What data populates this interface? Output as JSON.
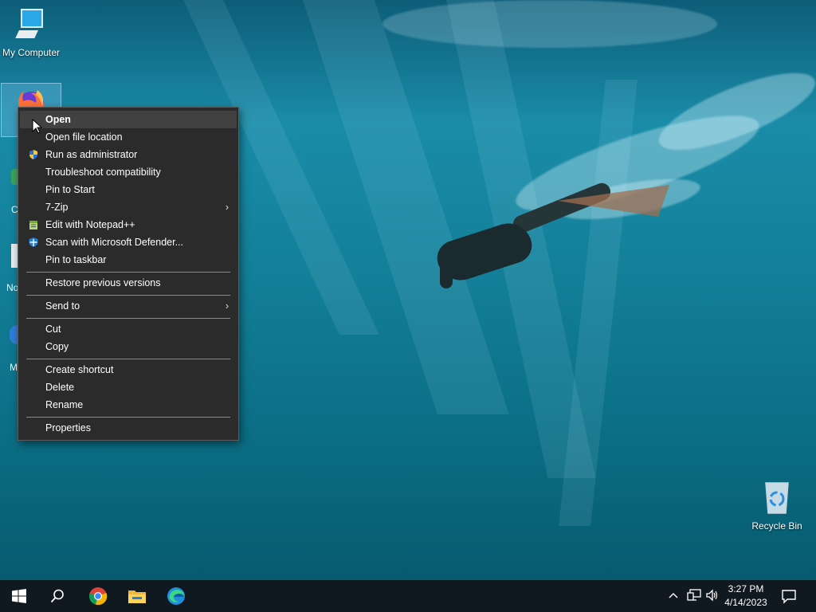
{
  "desktop": {
    "icons": [
      {
        "label": "My Computer"
      },
      {
        "label": "Recycle Bin"
      }
    ],
    "partial_labels": [
      "C",
      "No",
      "M"
    ]
  },
  "context_menu": {
    "items": [
      {
        "label": "Open",
        "highlighted": true
      },
      {
        "label": "Open file location"
      },
      {
        "label": "Run as administrator",
        "icon": "uac-shield-icon"
      },
      {
        "label": "Troubleshoot compatibility"
      },
      {
        "label": "Pin to Start"
      },
      {
        "label": "7-Zip",
        "submenu": true
      },
      {
        "label": "Edit with Notepad++",
        "icon": "notepadpp-icon"
      },
      {
        "label": "Scan with Microsoft Defender...",
        "icon": "defender-icon"
      },
      {
        "label": "Pin to taskbar"
      },
      {
        "label": "Restore previous versions"
      },
      {
        "label": "Send to",
        "submenu": true
      },
      {
        "label": "Cut"
      },
      {
        "label": "Copy"
      },
      {
        "label": "Create shortcut"
      },
      {
        "label": "Delete"
      },
      {
        "label": "Rename"
      },
      {
        "label": "Properties"
      }
    ],
    "arrow_glyph": "›"
  },
  "taskbar": {
    "pinned": [
      "start-icon",
      "search-icon",
      "chrome-icon",
      "file-explorer-icon",
      "edge-icon"
    ],
    "tray": {
      "time": "3:27 PM",
      "date": "4/14/2023"
    }
  },
  "colors": {
    "menu_bg": "#2b2b2b",
    "menu_highlight": "#414141",
    "taskbar_bg": "#101820"
  }
}
